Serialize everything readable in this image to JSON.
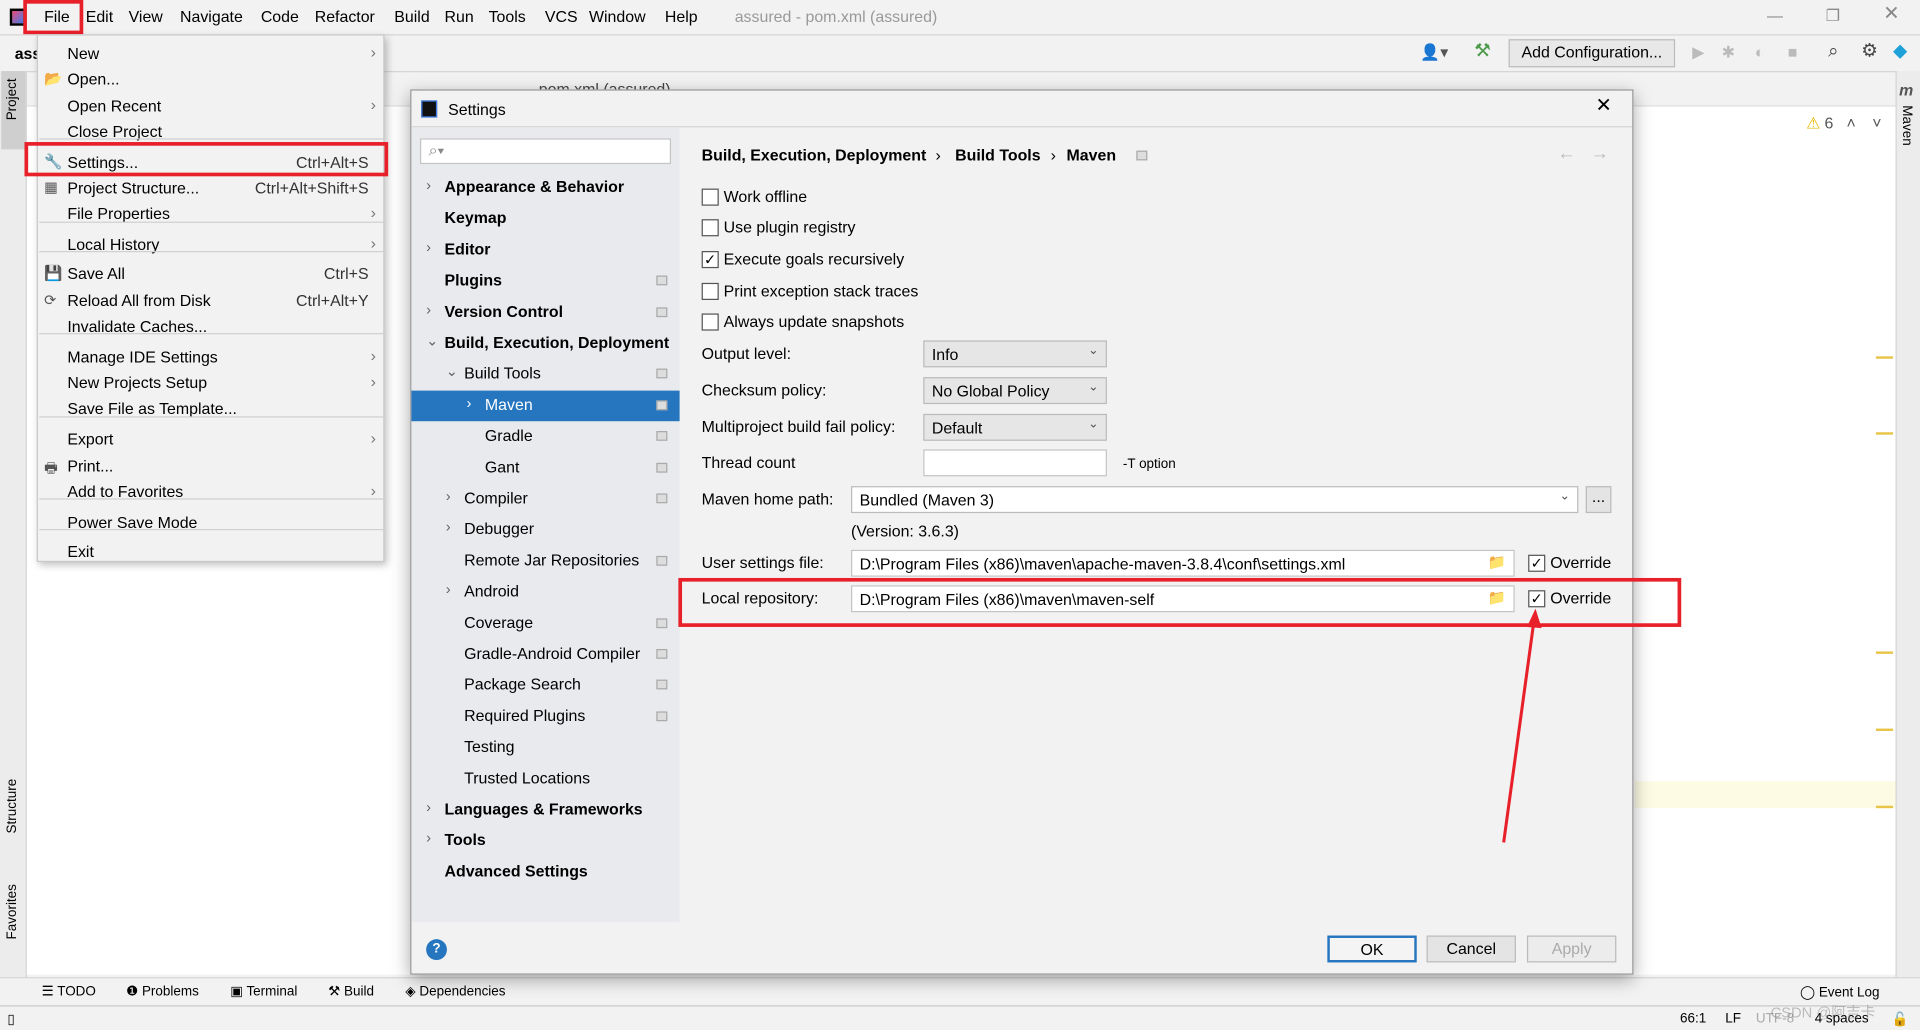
{
  "window": {
    "title": "assured - pom.xml (assured)",
    "project_label": "ass",
    "editor_tab": "pom.xml (assured)"
  },
  "menubar": [
    "File",
    "Edit",
    "View",
    "Navigate",
    "Code",
    "Refactor",
    "Build",
    "Run",
    "Tools",
    "VCS",
    "Window",
    "Help"
  ],
  "toolbar": {
    "add_configuration": "Add Configuration..."
  },
  "editor": {
    "warning_count": "6"
  },
  "side_tools": {
    "project": "Project",
    "structure": "Structure",
    "favorites": "Favorites",
    "maven": "Maven"
  },
  "file_menu": [
    {
      "label": "New",
      "submenu": true
    },
    {
      "label": "Open...",
      "icon": "folder-open-icon"
    },
    {
      "label": "Open Recent",
      "submenu": true
    },
    {
      "label": "Close Project",
      "sep_after": true
    },
    {
      "label": "Settings...",
      "shortcut": "Ctrl+Alt+S",
      "icon": "wrench-icon",
      "highlighted": true
    },
    {
      "label": "Project Structure...",
      "shortcut": "Ctrl+Alt+Shift+S",
      "icon": "project-structure-icon"
    },
    {
      "label": "File Properties",
      "submenu": true,
      "sep_after": true
    },
    {
      "label": "Local History",
      "submenu": true,
      "sep_after": true
    },
    {
      "label": "Save All",
      "shortcut": "Ctrl+S",
      "icon": "save-icon"
    },
    {
      "label": "Reload All from Disk",
      "shortcut": "Ctrl+Alt+Y",
      "icon": "reload-icon"
    },
    {
      "label": "Invalidate Caches...",
      "sep_after": true
    },
    {
      "label": "Manage IDE Settings",
      "submenu": true
    },
    {
      "label": "New Projects Setup",
      "submenu": true
    },
    {
      "label": "Save File as Template...",
      "sep_after": true
    },
    {
      "label": "Export",
      "submenu": true
    },
    {
      "label": "Print...",
      "icon": "print-icon"
    },
    {
      "label": "Add to Favorites",
      "submenu": true,
      "sep_after": true
    },
    {
      "label": "Power Save Mode",
      "sep_after": true
    },
    {
      "label": "Exit"
    }
  ],
  "settings": {
    "title": "Settings",
    "search_placeholder": "",
    "tree": [
      {
        "label": "Appearance & Behavior",
        "bold": true,
        "arrow": "right",
        "level": 0
      },
      {
        "label": "Keymap",
        "bold": true,
        "level": 0
      },
      {
        "label": "Editor",
        "bold": true,
        "arrow": "right",
        "level": 0
      },
      {
        "label": "Plugins",
        "bold": true,
        "level": 0,
        "project": true
      },
      {
        "label": "Version Control",
        "bold": true,
        "arrow": "right",
        "level": 0,
        "project": true
      },
      {
        "label": "Build, Execution, Deployment",
        "bold": true,
        "arrow": "down",
        "level": 0
      },
      {
        "label": "Build Tools",
        "arrow": "down",
        "level": 1,
        "project": true
      },
      {
        "label": "Maven",
        "arrow": "right",
        "level": 2,
        "project": true,
        "selected": true
      },
      {
        "label": "Gradle",
        "level": 2,
        "project": true
      },
      {
        "label": "Gant",
        "level": 2,
        "project": true
      },
      {
        "label": "Compiler",
        "arrow": "right",
        "level": 1,
        "project": true
      },
      {
        "label": "Debugger",
        "arrow": "right",
        "level": 1
      },
      {
        "label": "Remote Jar Repositories",
        "level": 1,
        "project": true
      },
      {
        "label": "Android",
        "arrow": "right",
        "level": 1
      },
      {
        "label": "Coverage",
        "level": 1,
        "project": true
      },
      {
        "label": "Gradle-Android Compiler",
        "level": 1,
        "project": true
      },
      {
        "label": "Package Search",
        "level": 1,
        "project": true
      },
      {
        "label": "Required Plugins",
        "level": 1,
        "project": true
      },
      {
        "label": "Testing",
        "level": 1
      },
      {
        "label": "Trusted Locations",
        "level": 1
      },
      {
        "label": "Languages & Frameworks",
        "bold": true,
        "arrow": "right",
        "level": 0
      },
      {
        "label": "Tools",
        "bold": true,
        "arrow": "right",
        "level": 0
      },
      {
        "label": "Advanced Settings",
        "bold": true,
        "level": 0
      }
    ],
    "breadcrumb": [
      "Build, Execution, Deployment",
      "Build Tools",
      "Maven"
    ],
    "checkboxes": [
      {
        "label": "Work offline",
        "checked": false
      },
      {
        "label": "Use plugin registry",
        "checked": false
      },
      {
        "label": "Execute goals recursively",
        "checked": true
      },
      {
        "label": "Print exception stack traces",
        "checked": false
      },
      {
        "label": "Always update snapshots",
        "checked": false
      }
    ],
    "output_level": {
      "label": "Output level:",
      "value": "Info"
    },
    "checksum_policy": {
      "label": "Checksum policy:",
      "value": "No Global Policy"
    },
    "fail_policy": {
      "label": "Multiproject build fail policy:",
      "value": "Default"
    },
    "thread_count": {
      "label": "Thread count",
      "value": "",
      "hint": "-T option"
    },
    "maven_home": {
      "label": "Maven home path:",
      "value": "Bundled (Maven 3)",
      "browse": "...",
      "version": "(Version: 3.6.3)"
    },
    "user_settings": {
      "label": "User settings file:",
      "value": "D:\\Program Files (x86)\\maven\\apache-maven-3.8.4\\conf\\settings.xml",
      "override_label": "Override",
      "override": true
    },
    "local_repo": {
      "label": "Local repository:",
      "value": "D:\\Program Files (x86)\\maven\\maven-self",
      "override_label": "Override",
      "override": true
    },
    "buttons": {
      "ok": "OK",
      "cancel": "Cancel",
      "apply": "Apply",
      "help": "?"
    }
  },
  "bottom_tools": [
    "TODO",
    "Problems",
    "Terminal",
    "Build",
    "Dependencies"
  ],
  "event_log": "Event Log",
  "status": {
    "position": "66:1",
    "line_sep": "LF",
    "encoding": "UTF-8",
    "indent": "4 spaces"
  },
  "watermark": "CSDN @阿吉卡",
  "colors": {
    "selection": "#2675bf",
    "highlight_box": "#e8202a",
    "annotation_arrow": "#e8202a"
  }
}
